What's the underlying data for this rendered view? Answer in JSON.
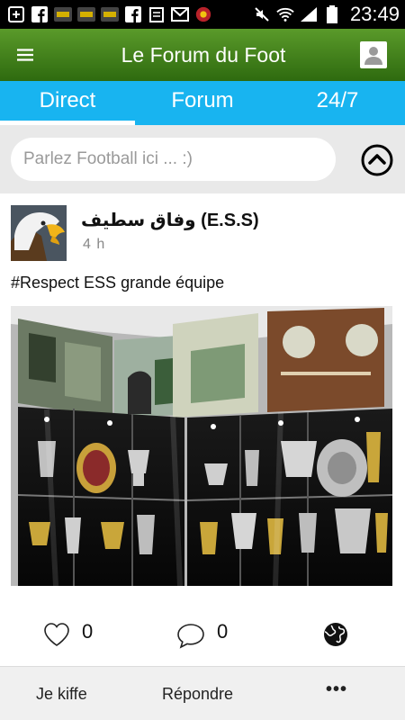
{
  "status_bar": {
    "time": "23:49",
    "icons": [
      "add-icon",
      "facebook-icon",
      "notification-app-icon",
      "notification-app-icon",
      "notification-app-icon",
      "facebook-icon",
      "clipboard-icon",
      "gmail-icon",
      "game-icon",
      "mute-icon",
      "wifi-icon",
      "signal-icon",
      "battery-icon"
    ]
  },
  "app_bar": {
    "title": "Le Forum du Foot"
  },
  "tabs": [
    {
      "label": "Direct",
      "active": true
    },
    {
      "label": "Forum",
      "active": false
    },
    {
      "label": "24/7",
      "active": false
    }
  ],
  "search": {
    "placeholder": "Parlez Football ici ... :)"
  },
  "post": {
    "author": "وفاق سطيف (E.S.S)",
    "time_ago": "4 h",
    "text": "#Respect ESS grande équipe",
    "like_count": "0",
    "comment_count": "0"
  },
  "actions": {
    "like": "Je kiffe",
    "reply": "Répondre",
    "more": "•••"
  },
  "colors": {
    "app_bar": "#3f7f1a",
    "tabs": "#18b4f0",
    "background": "#e9e9e9"
  }
}
